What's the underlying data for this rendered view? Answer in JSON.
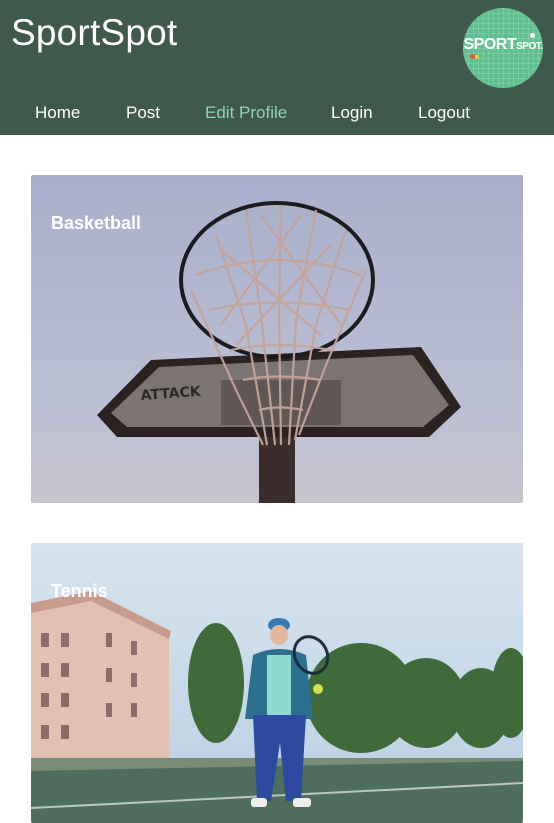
{
  "app": {
    "title": "SportSpot",
    "logo_text_main": "SPORT",
    "logo_text_small": "SPOT."
  },
  "nav": {
    "items": [
      {
        "label": "Home",
        "active": false
      },
      {
        "label": "Post",
        "active": false
      },
      {
        "label": "Edit Profile",
        "active": true
      },
      {
        "label": "Login",
        "active": false
      },
      {
        "label": "Logout",
        "active": false
      }
    ]
  },
  "cards": [
    {
      "label": "Basketball",
      "image": "basketball-hoop-photo"
    },
    {
      "label": "Tennis",
      "image": "tennis-player-photo"
    }
  ],
  "colors": {
    "header_bg": "#3f5a4c",
    "logo_bg": "#5fbf8e",
    "nav_active": "#8fd4b0",
    "nav_text": "#ffffff"
  }
}
